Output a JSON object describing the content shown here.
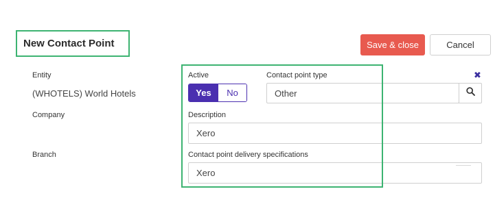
{
  "header": {
    "title": "New Contact Point",
    "save_close_label": "Save & close",
    "cancel_label": "Cancel"
  },
  "left_panel": {
    "entity_label": "Entity",
    "entity_value": "(WHOTELS) World Hotels",
    "company_label": "Company",
    "branch_label": "Branch"
  },
  "form": {
    "active_label": "Active",
    "active_options": {
      "yes": "Yes",
      "no": "No"
    },
    "active_selected": "Yes",
    "contact_point_type_label": "Contact point type",
    "contact_point_type_value": "Other",
    "description_label": "Description",
    "description_value": "Xero",
    "delivery_spec_label": "Contact point delivery specifications",
    "delivery_spec_value": "Xero"
  },
  "icons": {
    "search": "search-icon",
    "close": "close-icon"
  },
  "colors": {
    "accent": "#4a2fb0",
    "save_button": "#e85a4f",
    "highlight_border": "#3cb371"
  }
}
